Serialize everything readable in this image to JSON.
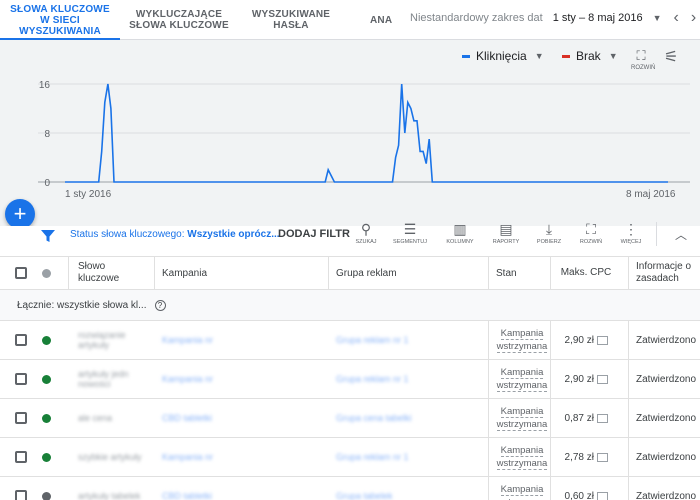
{
  "tabs": [
    {
      "label_line1": "SŁOWA KLUCZOWE",
      "label_line2": "W SIECI",
      "label_line3": "WYSZUKIWANIA"
    },
    {
      "label_line1": "WYKLUCZAJĄCE",
      "label_line2": "SŁOWA KLUCZOWE"
    },
    {
      "label_line1": "WYSZUKIWANE",
      "label_line2": "HASŁA"
    },
    {
      "label_line1": "ANA"
    }
  ],
  "date_range": {
    "label": "Niestandardowy zakres dat",
    "value": "1 sty – 8 maj 2016",
    "prev_icon": "chevron-left-icon",
    "next_icon": "chevron-right-icon"
  },
  "chart_controls": {
    "metric1": "Kliknięcia",
    "metric1_color": "#1a73e8",
    "metric2": "Brak",
    "metric2_color": "#d93025",
    "expand_label": "ROZWIŃ"
  },
  "chart_data": {
    "type": "line",
    "series": [
      {
        "name": "Kliknięcia",
        "color": "#1a73e8",
        "values": [
          0,
          0,
          0,
          0,
          0,
          0,
          0,
          0,
          0,
          0,
          0,
          0,
          5,
          13,
          16,
          12,
          0,
          0,
          0,
          0,
          0,
          0,
          0,
          0,
          0,
          0,
          0,
          0,
          0,
          0,
          0,
          0,
          0,
          0,
          0,
          0,
          0,
          0,
          0,
          0,
          0,
          0,
          0,
          0,
          0,
          0,
          0,
          0,
          0,
          0,
          0,
          0,
          0,
          0,
          0,
          0,
          0,
          0,
          0,
          0,
          0,
          0,
          0,
          0,
          0,
          0,
          0,
          0,
          0,
          0,
          0,
          0,
          0,
          0,
          0,
          0,
          0,
          0,
          0,
          0,
          0,
          0,
          0,
          0,
          0,
          0,
          2,
          1,
          0,
          0,
          0,
          0,
          0,
          0,
          0,
          0,
          0,
          0,
          0,
          0,
          0,
          0,
          0,
          0,
          0,
          0,
          0,
          0,
          4,
          6,
          16,
          8,
          13,
          12,
          10,
          10,
          5,
          5,
          3,
          7,
          0,
          0,
          0,
          0,
          0,
          0,
          0,
          0,
          0,
          0,
          0,
          0,
          0,
          0,
          0,
          0,
          0,
          0,
          0,
          0,
          0,
          0,
          0,
          0,
          0,
          0,
          0,
          0,
          0,
          0,
          0,
          0,
          0,
          0,
          0,
          0,
          0,
          0,
          0,
          0,
          0,
          0,
          0,
          0,
          0,
          0,
          0,
          0,
          0,
          0,
          0,
          0,
          0,
          0,
          0,
          0,
          0,
          0,
          0,
          0,
          0,
          0,
          0,
          0,
          0,
          0,
          0,
          0,
          0,
          0,
          0,
          0,
          0,
          0,
          0,
          0,
          0,
          0
        ]
      }
    ],
    "x_start_label": "1 sty 2016",
    "x_end_label": "8 maj 2016",
    "y_ticks": [
      0,
      8,
      16
    ],
    "ylim": [
      0,
      16
    ],
    "grid": true
  },
  "fab_label": "+",
  "filter": {
    "prefix": "Status słowa kluczowego: ",
    "value": "Wszystkie oprócz...",
    "add_label": "DODAJ FILTR"
  },
  "tools": [
    {
      "icon": "search-icon",
      "label": "SZUKAJ",
      "glyph": "🔍"
    },
    {
      "icon": "segment-icon",
      "label": "SEGMENTUJ",
      "glyph": "☰"
    },
    {
      "icon": "columns-icon",
      "label": "KOLUMNY",
      "glyph": "▥"
    },
    {
      "icon": "reports-icon",
      "label": "RAPORTY",
      "glyph": "▤"
    },
    {
      "icon": "download-icon",
      "label": "POBIERZ",
      "glyph": "⤓"
    },
    {
      "icon": "expand-icon",
      "label": "ROZWIŃ",
      "glyph": "⛶"
    },
    {
      "icon": "more-icon",
      "label": "WIĘCEJ",
      "glyph": "⋮"
    }
  ],
  "table": {
    "headers": {
      "keyword": "Słowo kluczowe",
      "campaign": "Kampania",
      "ad_group": "Grupa reklam",
      "status": "Stan",
      "max_cpc": "Maks. CPC",
      "policy": "Informacje o zasadach"
    },
    "total_label": "Łącznie: wszystkie słowa kl...",
    "rows": [
      {
        "keyword": "rozwiązanie artykuły",
        "campaign": "Kampania nr",
        "ad_group": "Grupa reklam nr 1",
        "status_line1": "Kampania",
        "status_line2": "wstrzymana",
        "cpc": "2,90 zł",
        "policy": "Zatwierdzono",
        "dot_color": "#188038"
      },
      {
        "keyword": "artykuły jedn nowości",
        "campaign": "Kampania nr",
        "ad_group": "Grupa reklam nr 1",
        "status_line1": "Kampania",
        "status_line2": "wstrzymana",
        "cpc": "2,90 zł",
        "policy": "Zatwierdzono",
        "dot_color": "#188038"
      },
      {
        "keyword": "ale cena",
        "campaign": "CBD tabletki",
        "ad_group": "Grupa cena tabelki",
        "status_line1": "Kampania",
        "status_line2": "wstrzymana",
        "cpc": "0,87 zł",
        "policy": "Zatwierdzono",
        "dot_color": "#188038"
      },
      {
        "keyword": "szybkie artykuły",
        "campaign": "Kampania nr",
        "ad_group": "Grupa reklam nr 1",
        "status_line1": "Kampania",
        "status_line2": "wstrzymana",
        "cpc": "2,78 zł",
        "policy": "Zatwierdzono",
        "dot_color": "#188038"
      },
      {
        "keyword": "artykuły tabelek",
        "campaign": "CBD tabletki",
        "ad_group": "Grupa tabelek",
        "status_line1": "Kampania",
        "status_line2": "wstrzymana",
        "cpc": "0,60 zł",
        "policy": "Zatwierdzono",
        "dot_color": "#5f6368"
      }
    ]
  }
}
